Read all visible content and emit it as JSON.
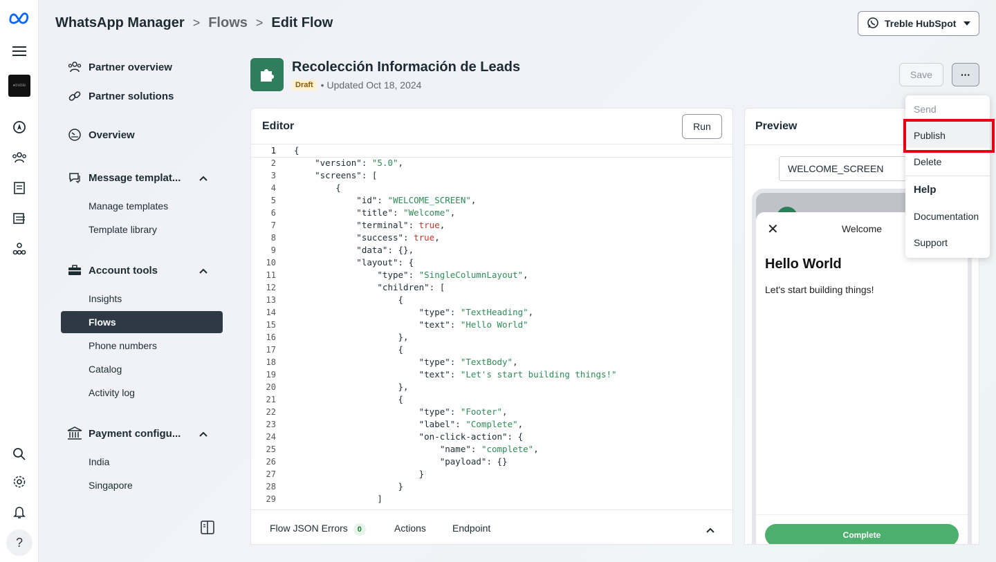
{
  "breadcrumb": {
    "items": [
      "WhatsApp Manager",
      "Flows",
      "Edit Flow"
    ]
  },
  "account": {
    "name": "Treble HubSpot"
  },
  "sidebar": {
    "partner_overview": "Partner overview",
    "partner_solutions": "Partner solutions",
    "overview": "Overview",
    "message_templates": "Message templat...",
    "manage_templates": "Manage templates",
    "template_library": "Template library",
    "account_tools": "Account tools",
    "insights": "Insights",
    "flows": "Flows",
    "phone_numbers": "Phone numbers",
    "catalog": "Catalog",
    "activity_log": "Activity log",
    "payment_config": "Payment configu...",
    "india": "India",
    "singapore": "Singapore"
  },
  "flow": {
    "title": "Recolección Información de Leads",
    "status": "Draft",
    "updated": "• Updated Oct 18, 2024",
    "save_label": "Save",
    "more_label": "···"
  },
  "editor": {
    "title": "Editor",
    "run_label": "Run",
    "code_lines": [
      "{",
      "    \"version\": \"5.0\",",
      "    \"screens\": [",
      "        {",
      "            \"id\": \"WELCOME_SCREEN\",",
      "            \"title\": \"Welcome\",",
      "            \"terminal\": true,",
      "            \"success\": true,",
      "            \"data\": {},",
      "            \"layout\": {",
      "                \"type\": \"SingleColumnLayout\",",
      "                \"children\": [",
      "                    {",
      "                        \"type\": \"TextHeading\",",
      "                        \"text\": \"Hello World\"",
      "                    },",
      "                    {",
      "                        \"type\": \"TextBody\",",
      "                        \"text\": \"Let's start building things!\"",
      "                    },",
      "                    {",
      "                        \"type\": \"Footer\",",
      "                        \"label\": \"Complete\",",
      "                        \"on-click-action\": {",
      "                            \"name\": \"complete\",",
      "                            \"payload\": {}",
      "                        }",
      "                    }",
      "                ]"
    ],
    "footer": {
      "errors_label": "Flow JSON Errors",
      "errors_count": "0",
      "actions_label": "Actions",
      "endpoint_label": "Endpoint"
    }
  },
  "preview": {
    "title": "Preview",
    "screen_select": "WELCOME_SCREEN",
    "screen_title": "Welcome",
    "heading": "Hello World",
    "body": "Let's start building things!",
    "button": "Complete"
  },
  "menu": {
    "send": "Send",
    "publish": "Publish",
    "delete": "Delete",
    "help_section": "Help",
    "documentation": "Documentation",
    "support": "Support"
  },
  "colors": {
    "active_nav": "#2d3a46",
    "flow_icon": "#2e7d5b",
    "highlight_box": "#e60012",
    "complete_button": "#4caf6d"
  }
}
